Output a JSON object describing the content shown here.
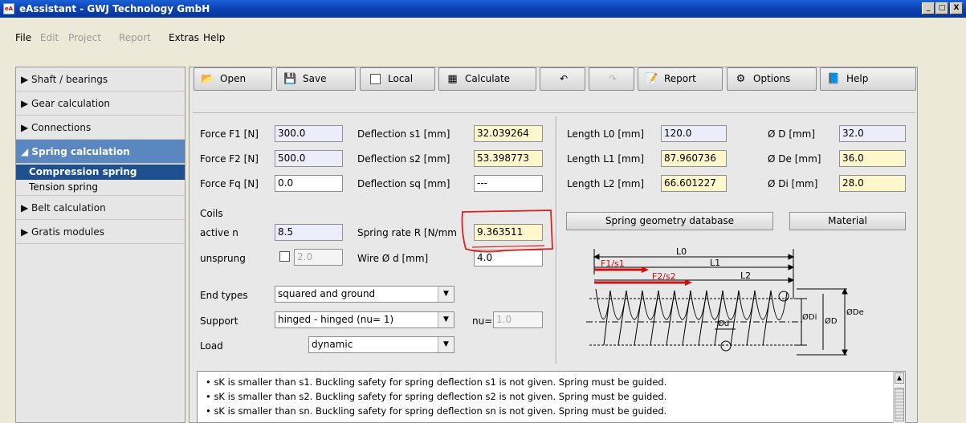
{
  "window": {
    "title": "eAssistant - GWJ Technology GmbH",
    "icon_text": "eA",
    "min_label": "_",
    "max_label": "□",
    "close_label": "X"
  },
  "menu": [
    "File",
    "Edit",
    "Project",
    "Report",
    "Extras",
    "Help"
  ],
  "sidebar": {
    "items": [
      {
        "label": "▶ Shaft / bearings"
      },
      {
        "label": "▶ Gear calculation"
      },
      {
        "label": "▶ Connections"
      },
      {
        "label": "◢ Spring calculation"
      },
      {
        "label": "▶ Belt calculation"
      },
      {
        "label": "▶ Gratis modules"
      }
    ],
    "subitems": [
      "Compression spring",
      "Tension spring"
    ]
  },
  "toolbar": {
    "open": "Open",
    "save": "Save",
    "local": "Local",
    "calculate": "Calculate",
    "undo_icon": "↶",
    "redo_icon": "↷",
    "report": "Report",
    "options": "Options",
    "help": "Help"
  },
  "fields": {
    "f1_label": "Force F1 [N]",
    "f1": "300.0",
    "f2_label": "Force F2 [N]",
    "f2": "500.0",
    "fq_label": "Force Fq [N]",
    "fq": "0.0",
    "s1_label": "Deflection s1 [mm]",
    "s1": "32.039264",
    "s2_label": "Deflection s2 [mm]",
    "s2": "53.398773",
    "sq_label": "Deflection sq [mm]",
    "sq": "---",
    "l0_label": "Length L0 [mm]",
    "l0": "120.0",
    "l1_label": "Length L1 [mm]",
    "l1": "87.960736",
    "l2_label": "Length L2 [mm]",
    "l2": "66.601227",
    "d_label": "Ø D [mm]",
    "d": "32.0",
    "de_label": "Ø De [mm]",
    "de": "36.0",
    "di_label": "Ø Di [mm]",
    "di": "28.0",
    "coils_label": "Coils",
    "active_label": "active n",
    "active": "8.5",
    "unsprung_label": "unsprung",
    "unsprung": "2.0",
    "rate_label": "Spring rate R [N/mm",
    "rate": "9.363511",
    "wire_label": "Wire Ø d [mm]",
    "wire": "4.0",
    "end_label": "End types",
    "end": "squared and ground",
    "support_label": "Support",
    "support": "hinged - hinged (nu= 1)",
    "nu_label": "nu=",
    "nu": "1.0",
    "load_label": "Load",
    "load": "dynamic"
  },
  "buttons": {
    "geometry_db": "Spring geometry database",
    "material": "Material"
  },
  "diagram": {
    "L0": "L0",
    "L1": "L1",
    "L2": "L2",
    "F1s1": "F1/s1",
    "F2s2": "F2/s2",
    "d": "Ød",
    "Di": "ØDi",
    "D": "ØD",
    "De": "ØDe"
  },
  "messages": [
    "• sK is smaller than s1. Buckling safety for spring deflection s1 is not given. Spring must be guided.",
    "• sK is smaller than s2. Buckling safety for spring deflection s2 is not given. Spring must be guided.",
    "• sK is smaller than sn. Buckling safety for spring deflection sn is not given. Spring must be guided."
  ],
  "colors": {
    "highlight": "#e02020",
    "titlebar": "#0c3fb0",
    "input_bg": "#ececfa",
    "output_bg": "#fff7cc"
  }
}
